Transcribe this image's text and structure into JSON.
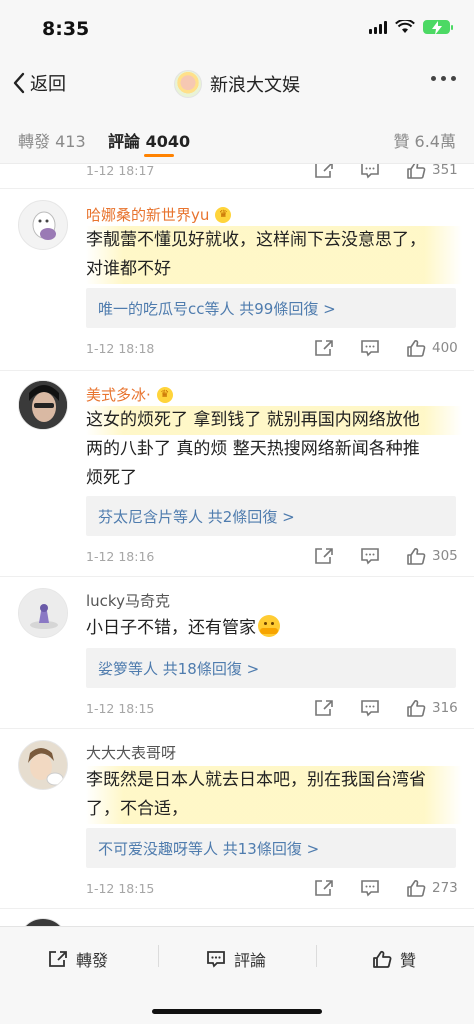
{
  "status_bar": {
    "time": "8:35"
  },
  "nav": {
    "back_label": "返回",
    "title": "新浪大文娱"
  },
  "tabs": {
    "repost": "轉發 413",
    "comment": "評論 4040",
    "like": "贊 6.4萬",
    "indicator_color": "#ff8200"
  },
  "top_row": {
    "time": "1-12 18:17",
    "likes": "351"
  },
  "comments": [
    {
      "user": "哈娜桑的新世界yu",
      "vip": true,
      "text_lines": [
        "李靓蕾不懂见好就收，这样闹下去没意思了，",
        "对谁都不好"
      ],
      "reply_summary": "唯一的吃瓜号cc等人 共99條回復 >",
      "time": "1-12 18:18",
      "likes": "400"
    },
    {
      "user": "美式多冰·",
      "vip": true,
      "text_lines": [
        "这女的烦死了 拿到钱了 就别再国内网络放他",
        "两的八卦了 真的烦 整天热搜网络新闻各种推",
        "烦死了"
      ],
      "reply_summary": "芬太尼含片等人 共2條回復 >",
      "time": "1-12 18:16",
      "likes": "305"
    },
    {
      "user": "lucky马奇克",
      "vip": false,
      "text_lines": [
        "小日子不错，还有管家"
      ],
      "reply_summary": "娑箩等人 共18條回復 >",
      "time": "1-12 18:15",
      "likes": "316"
    },
    {
      "user": "大大大表哥呀",
      "vip": false,
      "text_lines": [
        "李既然是日本人就去日本吧，别在我国台湾省",
        "了，不合适，"
      ],
      "reply_summary": "不可爱没趣呀等人 共13條回復 >",
      "time": "1-12 18:15",
      "likes": "273"
    }
  ],
  "bottom_bar": {
    "repost": "轉發",
    "comment": "評論",
    "like": "贊"
  },
  "colors": {
    "vip_name": "#e8742f",
    "link": "#4f7cae",
    "accent": "#ff8200"
  }
}
